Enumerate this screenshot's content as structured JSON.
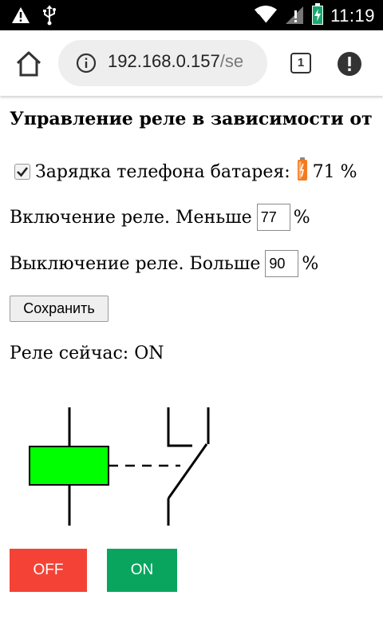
{
  "status_bar": {
    "time": "11:19",
    "icons": [
      "warning-icon",
      "usb-icon",
      "wifi-icon",
      "signal-icon",
      "battery-charging-icon"
    ]
  },
  "browser": {
    "url_host": "192.168.0.157",
    "url_path": "/se",
    "tab_count": "1"
  },
  "page": {
    "title": "Управление реле в зависимости от",
    "battery_label": "Зарядка телефона батарея:",
    "battery_checked": true,
    "battery_percent": "71 %",
    "on_label": "Включение  реле. Меньше",
    "on_value": "77",
    "on_unit": "%",
    "off_label": "Выключение реле. Больше",
    "off_value": "90",
    "off_unit": "%",
    "save_label": "Сохранить",
    "relay_status": "Реле сейчас: ON",
    "off_button": "OFF",
    "on_button": "ON"
  },
  "colors": {
    "coil": "#00ff00",
    "off_button": "#f44336",
    "on_button": "#09a55f"
  }
}
